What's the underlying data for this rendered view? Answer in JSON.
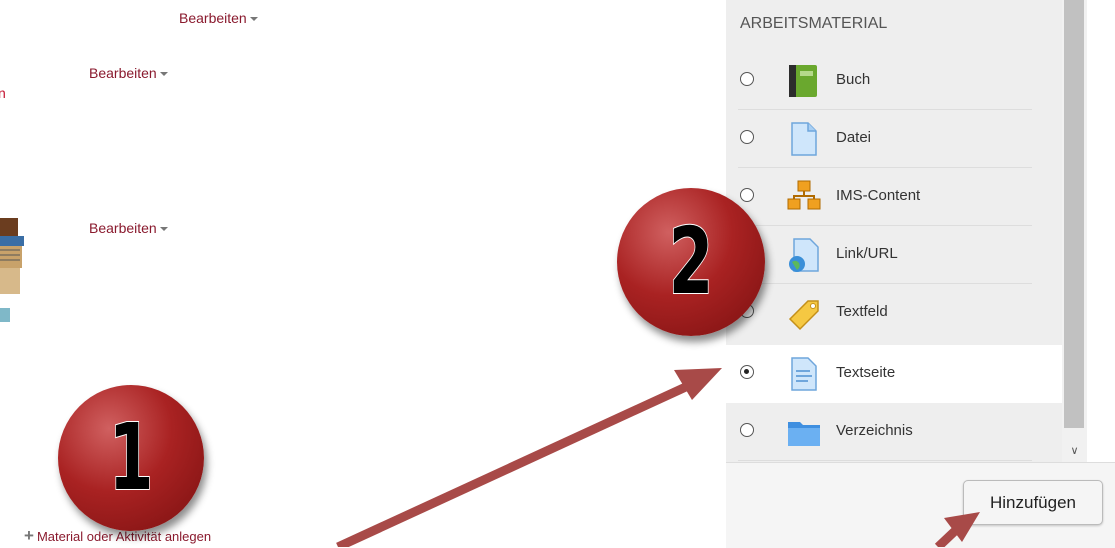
{
  "course": {
    "edit_label_1": "Bearbeiten",
    "edit_label_2": "Bearbeiten",
    "edit_label_3": "Bearbeiten",
    "red_fragment": "n",
    "add_activity_label": "Material oder Aktivität anlegen"
  },
  "chooser": {
    "section_title": "ARBEITSMATERIAL",
    "options": [
      {
        "label": "Buch",
        "icon": "book-icon",
        "selected": false
      },
      {
        "label": "Datei",
        "icon": "file-icon",
        "selected": false
      },
      {
        "label": "IMS-Content",
        "icon": "ims-content-icon",
        "selected": false
      },
      {
        "label": "Link/URL",
        "icon": "url-icon",
        "selected": false
      },
      {
        "label": "Textfeld",
        "icon": "label-tag-icon",
        "selected": false
      },
      {
        "label": "Textseite",
        "icon": "page-icon",
        "selected": true
      },
      {
        "label": "Verzeichnis",
        "icon": "folder-icon",
        "selected": false
      }
    ],
    "add_button_label": "Hinzufügen"
  },
  "callouts": {
    "badge_1": "1",
    "badge_2": "2"
  },
  "colors": {
    "link": "#8a1a2e",
    "badge": "#a92222",
    "arrow": "#a84a48"
  }
}
